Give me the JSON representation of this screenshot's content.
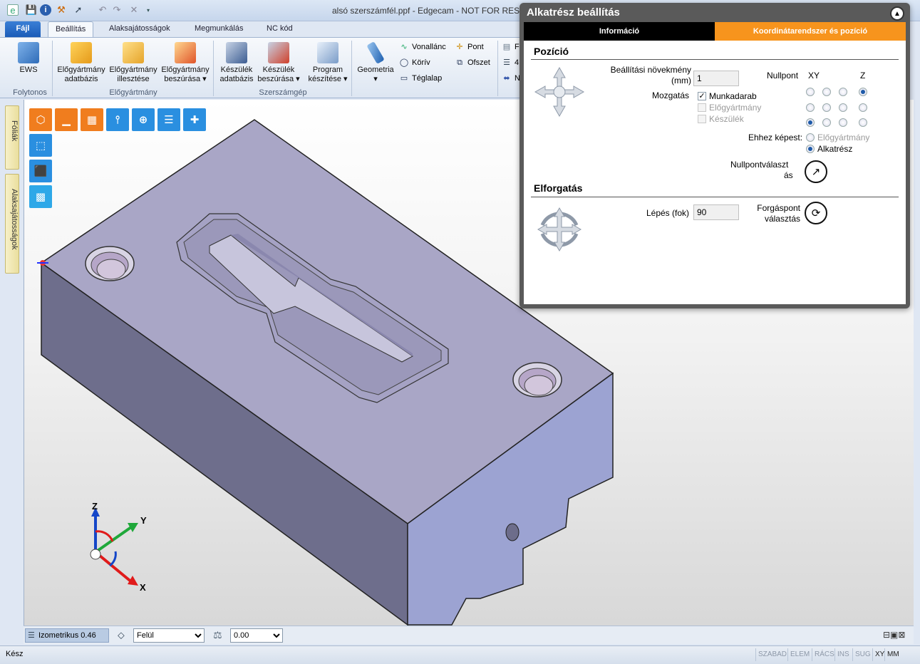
{
  "window": {
    "title": "alsó szerszámfél.ppf - Edgecam - NOT FOR RESALE"
  },
  "quick_access": {
    "icons": [
      "app-icon",
      "save-icon",
      "info-icon",
      "tools-icon",
      "arrow-icon",
      "undo-icon",
      "redo-icon",
      "close-icon",
      "dropdown-icon"
    ]
  },
  "tabs": {
    "file": "Fájl",
    "items": [
      "Beállítás",
      "Alaksajátosságok",
      "Megmunkálás",
      "NC kód"
    ]
  },
  "ribbon": {
    "ews": "EWS",
    "group_folytonos": "Folytonos",
    "blank_db": "Előgyártmány\nadatbázis",
    "blank_db_1": "Előgyártmány",
    "blank_db_2": "adatbázis",
    "blank_fit_1": "Előgyártmány",
    "blank_fit_2": "illesztése",
    "blank_insert_1": "Előgyártmány",
    "blank_insert_2": "beszúrása",
    "group_blank": "Előgyártmány",
    "fixture_db_1": "Készülék",
    "fixture_db_2": "adatbázis",
    "fixture_insert_1": "Készülék",
    "fixture_insert_2": "beszúrása",
    "program_1": "Program",
    "program_2": "készítése",
    "group_machine": "Szerszámgép",
    "geometry": "Geometria",
    "polyline": "Vonallánc",
    "circle": "Körív",
    "rectangle": "Téglalap",
    "point": "Pont",
    "offset": "Ofszet",
    "partial_1": "F",
    "partial_2": "4",
    "partial_3": "N"
  },
  "sidebar": {
    "tab1": "Fóliák",
    "tab2": "Alaksajátosságok"
  },
  "viewport": {
    "axis_x": "X",
    "axis_y": "Y",
    "axis_z": "Z",
    "colors": {
      "orange": "#f07d1e",
      "blue": "#2a8fe0",
      "part_top": "#a9a6c6",
      "part_side": "#6e6e8c"
    }
  },
  "viewbar": {
    "view_label": "Izometrikus 0.46",
    "plane_value": "Felül",
    "depth_value": "0.00"
  },
  "status": {
    "ready": "Kész",
    "boxes": [
      "SZABAD",
      "ELEM",
      "RÁCS",
      "INS",
      "SUG",
      "XY",
      "MM"
    ]
  },
  "dialog": {
    "title": "Alkatrész beállítás",
    "tab_info": "Információ",
    "tab_coord": "Koordinátarendszer és pozíció",
    "tab_coord_color": "#f7941d",
    "section_position": "Pozíció",
    "step_label_1": "Beállítási növekmény",
    "step_label_2": "(mm)",
    "step_value": "1",
    "move_label": "Mozgatás",
    "move_workpiece": "Munkadarab",
    "move_blank": "Előgyártmány",
    "move_fixture": "Készülék",
    "origin_label": "Nullpont",
    "col_xy": "XY",
    "col_z": "Z",
    "relative_label": "Ehhez képest:",
    "rel_blank": "Előgyártmány",
    "rel_part": "Alkatrész",
    "origin_select_1": "Nullpontválaszt",
    "origin_select_2": "ás",
    "section_rotation": "Elforgatás",
    "step_deg_label": "Lépés (fok)",
    "step_deg_value": "90",
    "pivot_1": "Forgáspont",
    "pivot_2": "választás"
  }
}
